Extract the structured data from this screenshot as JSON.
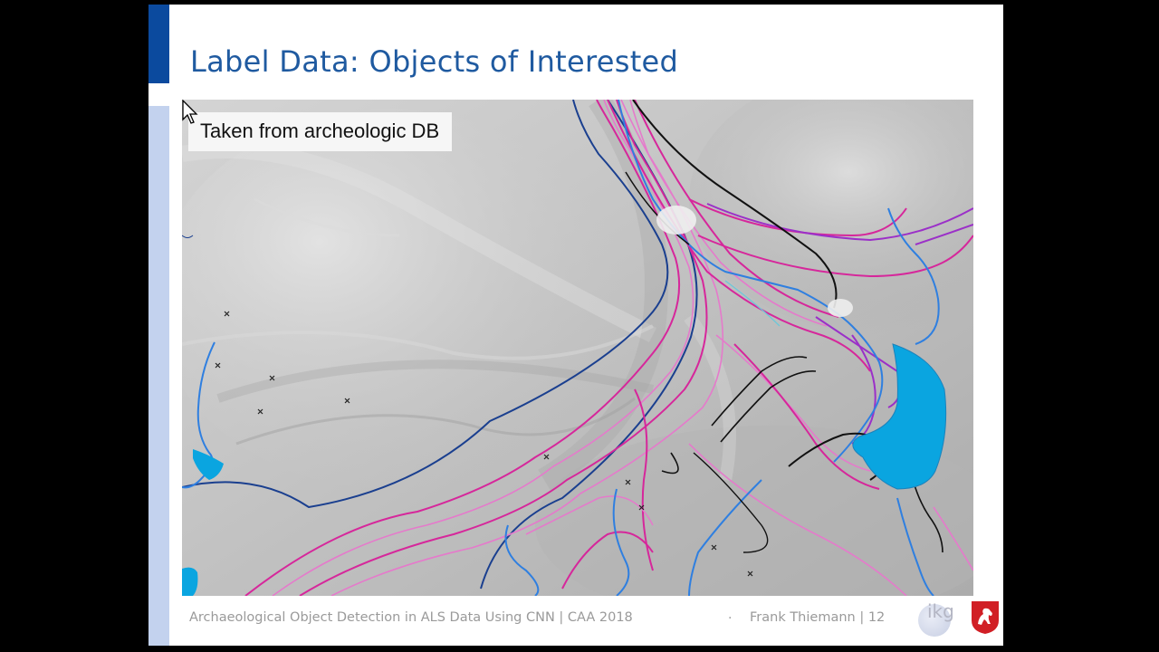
{
  "slide": {
    "title": "Label Data: Objects of Interested",
    "map_label": "Taken from archeologic DB",
    "footer_left": "Archaeological Object Detection in ALS Data Using CNN | CAA 2018",
    "footer_separator": "·",
    "footer_right": "Frank Thiemann | 12",
    "logo_text": "ikg"
  },
  "colors": {
    "accent": "#0b4a9e",
    "accent_light": "#c3d2ee",
    "title": "#1f5aa0",
    "water": "#0aa5e0",
    "contour_magenta": "#d6279b",
    "contour_pink": "#e57acb",
    "contour_purple": "#9b30c8",
    "stream_blue": "#2f7fe0",
    "contour_navy": "#1a3f8f",
    "path_black": "#111111",
    "crest_red": "#d11f25"
  },
  "icons": {
    "cursor": "mouse-pointer-icon",
    "crest": "horse-crest-icon"
  }
}
